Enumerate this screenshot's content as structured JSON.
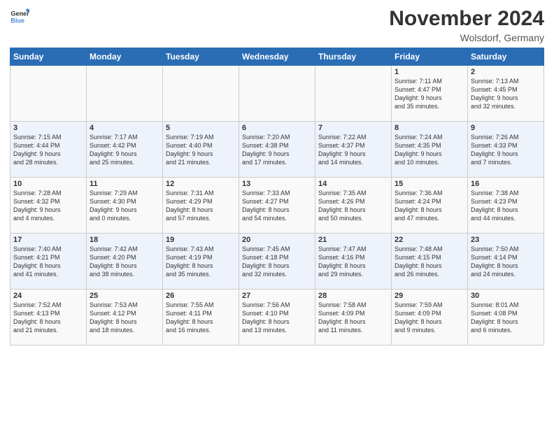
{
  "header": {
    "logo_general": "General",
    "logo_blue": "Blue",
    "month_year": "November 2024",
    "location": "Wolsdorf, Germany"
  },
  "days_of_week": [
    "Sunday",
    "Monday",
    "Tuesday",
    "Wednesday",
    "Thursday",
    "Friday",
    "Saturday"
  ],
  "weeks": [
    [
      {
        "day": "",
        "info": ""
      },
      {
        "day": "",
        "info": ""
      },
      {
        "day": "",
        "info": ""
      },
      {
        "day": "",
        "info": ""
      },
      {
        "day": "",
        "info": ""
      },
      {
        "day": "1",
        "info": "Sunrise: 7:11 AM\nSunset: 4:47 PM\nDaylight: 9 hours\nand 35 minutes."
      },
      {
        "day": "2",
        "info": "Sunrise: 7:13 AM\nSunset: 4:45 PM\nDaylight: 9 hours\nand 32 minutes."
      }
    ],
    [
      {
        "day": "3",
        "info": "Sunrise: 7:15 AM\nSunset: 4:44 PM\nDaylight: 9 hours\nand 28 minutes."
      },
      {
        "day": "4",
        "info": "Sunrise: 7:17 AM\nSunset: 4:42 PM\nDaylight: 9 hours\nand 25 minutes."
      },
      {
        "day": "5",
        "info": "Sunrise: 7:19 AM\nSunset: 4:40 PM\nDaylight: 9 hours\nand 21 minutes."
      },
      {
        "day": "6",
        "info": "Sunrise: 7:20 AM\nSunset: 4:38 PM\nDaylight: 9 hours\nand 17 minutes."
      },
      {
        "day": "7",
        "info": "Sunrise: 7:22 AM\nSunset: 4:37 PM\nDaylight: 9 hours\nand 14 minutes."
      },
      {
        "day": "8",
        "info": "Sunrise: 7:24 AM\nSunset: 4:35 PM\nDaylight: 9 hours\nand 10 minutes."
      },
      {
        "day": "9",
        "info": "Sunrise: 7:26 AM\nSunset: 4:33 PM\nDaylight: 9 hours\nand 7 minutes."
      }
    ],
    [
      {
        "day": "10",
        "info": "Sunrise: 7:28 AM\nSunset: 4:32 PM\nDaylight: 9 hours\nand 4 minutes."
      },
      {
        "day": "11",
        "info": "Sunrise: 7:29 AM\nSunset: 4:30 PM\nDaylight: 9 hours\nand 0 minutes."
      },
      {
        "day": "12",
        "info": "Sunrise: 7:31 AM\nSunset: 4:29 PM\nDaylight: 8 hours\nand 57 minutes."
      },
      {
        "day": "13",
        "info": "Sunrise: 7:33 AM\nSunset: 4:27 PM\nDaylight: 8 hours\nand 54 minutes."
      },
      {
        "day": "14",
        "info": "Sunrise: 7:35 AM\nSunset: 4:26 PM\nDaylight: 8 hours\nand 50 minutes."
      },
      {
        "day": "15",
        "info": "Sunrise: 7:36 AM\nSunset: 4:24 PM\nDaylight: 8 hours\nand 47 minutes."
      },
      {
        "day": "16",
        "info": "Sunrise: 7:38 AM\nSunset: 4:23 PM\nDaylight: 8 hours\nand 44 minutes."
      }
    ],
    [
      {
        "day": "17",
        "info": "Sunrise: 7:40 AM\nSunset: 4:21 PM\nDaylight: 8 hours\nand 41 minutes."
      },
      {
        "day": "18",
        "info": "Sunrise: 7:42 AM\nSunset: 4:20 PM\nDaylight: 8 hours\nand 38 minutes."
      },
      {
        "day": "19",
        "info": "Sunrise: 7:43 AM\nSunset: 4:19 PM\nDaylight: 8 hours\nand 35 minutes."
      },
      {
        "day": "20",
        "info": "Sunrise: 7:45 AM\nSunset: 4:18 PM\nDaylight: 8 hours\nand 32 minutes."
      },
      {
        "day": "21",
        "info": "Sunrise: 7:47 AM\nSunset: 4:16 PM\nDaylight: 8 hours\nand 29 minutes."
      },
      {
        "day": "22",
        "info": "Sunrise: 7:48 AM\nSunset: 4:15 PM\nDaylight: 8 hours\nand 26 minutes."
      },
      {
        "day": "23",
        "info": "Sunrise: 7:50 AM\nSunset: 4:14 PM\nDaylight: 8 hours\nand 24 minutes."
      }
    ],
    [
      {
        "day": "24",
        "info": "Sunrise: 7:52 AM\nSunset: 4:13 PM\nDaylight: 8 hours\nand 21 minutes."
      },
      {
        "day": "25",
        "info": "Sunrise: 7:53 AM\nSunset: 4:12 PM\nDaylight: 8 hours\nand 18 minutes."
      },
      {
        "day": "26",
        "info": "Sunrise: 7:55 AM\nSunset: 4:11 PM\nDaylight: 8 hours\nand 16 minutes."
      },
      {
        "day": "27",
        "info": "Sunrise: 7:56 AM\nSunset: 4:10 PM\nDaylight: 8 hours\nand 13 minutes."
      },
      {
        "day": "28",
        "info": "Sunrise: 7:58 AM\nSunset: 4:09 PM\nDaylight: 8 hours\nand 11 minutes."
      },
      {
        "day": "29",
        "info": "Sunrise: 7:59 AM\nSunset: 4:09 PM\nDaylight: 8 hours\nand 9 minutes."
      },
      {
        "day": "30",
        "info": "Sunrise: 8:01 AM\nSunset: 4:08 PM\nDaylight: 8 hours\nand 6 minutes."
      }
    ]
  ]
}
